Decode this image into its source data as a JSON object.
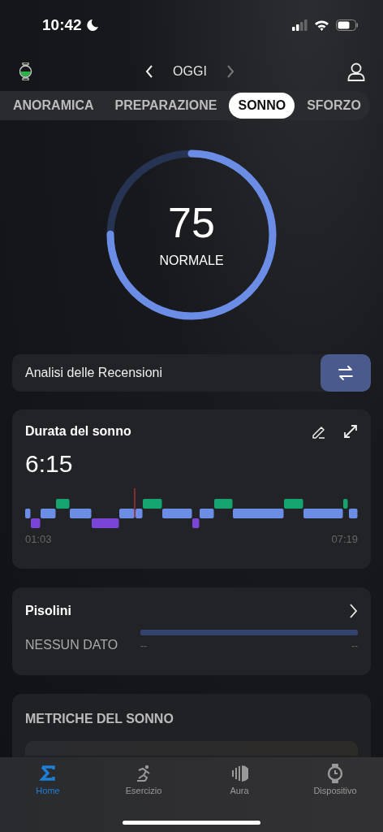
{
  "status_bar": {
    "time": "10:42"
  },
  "top_nav": {
    "date_label": "OGGI"
  },
  "tabs": [
    {
      "label": "ANORAMICA",
      "selected": false
    },
    {
      "label": "PREPARAZIONE",
      "selected": false
    },
    {
      "label": "SONNO",
      "selected": true
    },
    {
      "label": "SFORZO",
      "selected": false
    }
  ],
  "score": {
    "value": "75",
    "rating": "NORMALE",
    "level": 0.75
  },
  "review_bar": {
    "label": "Analisi delle Recensioni"
  },
  "sleep_duration": {
    "title": "Durata del sonno",
    "value": "6:15",
    "start_time": "01:03",
    "end_time": "07:19"
  },
  "naps": {
    "title": "Pisolini",
    "status": "NESSUN DATO",
    "start_label": "--",
    "end_label": "--"
  },
  "sleep_metrics": {
    "title": "METRICHE DEL SONNO"
  },
  "bottom_tabs": [
    {
      "label": "Home",
      "selected": true
    },
    {
      "label": "Esercizio",
      "selected": false
    },
    {
      "label": "Aura",
      "selected": false
    },
    {
      "label": "Dispositivo",
      "selected": false
    }
  ]
}
